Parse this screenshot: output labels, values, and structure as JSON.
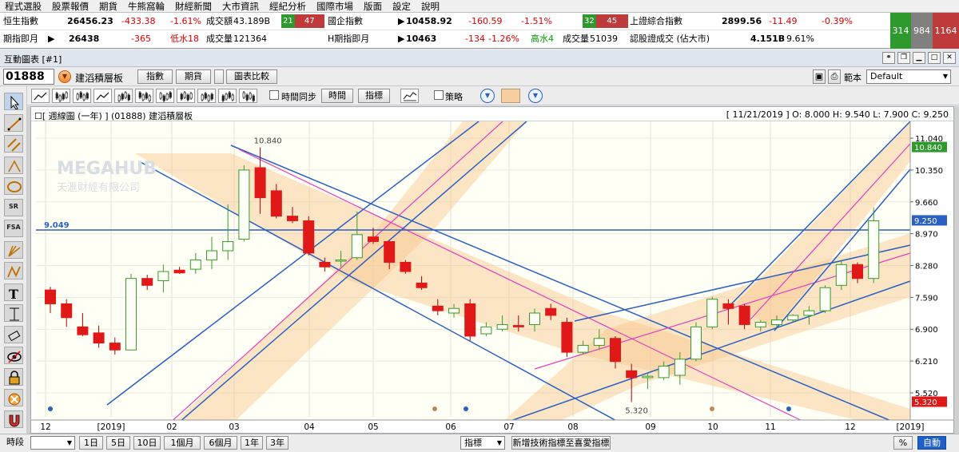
{
  "menu": [
    "程式選股",
    "股票報價",
    "期貨",
    "牛熊窩輪",
    "財經新聞",
    "大市資訊",
    "經紀分析",
    "國際市場",
    "版面",
    "設定",
    "說明"
  ],
  "ticker": {
    "r1": {
      "hsi_label": "恒生指數",
      "hsi_value": "26456.23",
      "hsi_change": "-433.38",
      "hsi_pct": "-1.61%",
      "turnover_label": "成交額",
      "turnover_value": "43.189B",
      "adv_up": "21",
      "adv_down": "47",
      "hsce_label": "國企指數",
      "hsce_value": "10458.92",
      "hsce_change": "-160.59",
      "hsce_pct": "-1.51%",
      "adv2_up": "32",
      "adv2_down": "45",
      "sse_label": "上證綜合指數",
      "sse_value": "2899.56",
      "sse_change": "-11.49",
      "sse_pct": "-0.39%"
    },
    "r2": {
      "fut_label": "期指即月",
      "fut_value": "26438",
      "fut_change": "-365",
      "fut_note": "低水18",
      "vol_label": "成交量",
      "vol_value": "121364",
      "hfut_label": "H期指即月",
      "hfut_value": "10463",
      "hfut_change": "-134",
      "hfut_pct": "-1.26%",
      "hfut_note": "高水4",
      "hvol_label": "成交量",
      "hvol_value": "51039",
      "warrant_label": "認股證成交 (佔大市)",
      "warrant_value": "4.151B",
      "warrant_pct": "9.61%"
    },
    "breadth": {
      "up": "314",
      "flat": "984",
      "down": "1164"
    },
    "colors": {
      "up": "#2e9a2e",
      "flat": "#808080",
      "down": "#bf3a3a"
    }
  },
  "window": {
    "title": "互動圖表 [#1]"
  },
  "control": {
    "code": "01888",
    "name": "建滔積層板",
    "btn_index": "指數",
    "btn_futures": "期貨",
    "btn_compare": "圖表比較",
    "scope_label": "範本",
    "scope_value": "Default"
  },
  "toolbar": {
    "sync_label": "時間同步",
    "time_btn": "時間",
    "indicator_btn": "指標",
    "strategy_label": "策略"
  },
  "left_tools": [
    "pointer-tool",
    "line-tool",
    "parallel-tool",
    "fibo-arc-tool",
    "ellipse-tool",
    "sr-tool",
    "fsa-tool",
    "fan-tool",
    "retrace-tool",
    "text-tool",
    "range-tool",
    "eraser-tool",
    "hide-tool",
    "lock-tool",
    "delete-tool",
    "magnet-tool"
  ],
  "chart": {
    "header_left": "週線圖 (一年) ] (01888) 建滔積層板",
    "header_right": "[ 11/21/2019 ]  O: 8.000  H: 9.540  L: 7.900  C: 9.250",
    "watermark_main": "MEGAHUB",
    "watermark_sub": "天滙財經有限公司"
  },
  "chart_data": {
    "type": "candlestick",
    "interval": "weekly",
    "y_ticks": [
      11.04,
      10.35,
      9.66,
      8.97,
      8.28,
      7.59,
      6.9,
      6.21,
      5.52
    ],
    "ylim": [
      5.0,
      11.3
    ],
    "x_ticks": [
      "12",
      "[2019]",
      "02",
      "03",
      "04",
      "05",
      "06",
      "07",
      "08",
      "09",
      "10",
      "11",
      "12",
      "[2019]"
    ],
    "high_label": "10.840",
    "low_label": "5.320",
    "hline_label": "9.049",
    "hline_value": 9.049,
    "last_value_label": "9.250",
    "max_value_label": "10.840",
    "min_value_label": "5.320",
    "candles": [
      {
        "o": 7.75,
        "h": 7.82,
        "l": 7.25,
        "c": 7.45
      },
      {
        "o": 7.45,
        "h": 7.55,
        "l": 6.95,
        "c": 7.15
      },
      {
        "o": 6.95,
        "h": 7.25,
        "l": 6.75,
        "c": 6.78
      },
      {
        "o": 6.82,
        "h": 6.98,
        "l": 6.5,
        "c": 6.6
      },
      {
        "o": 6.6,
        "h": 6.72,
        "l": 6.35,
        "c": 6.45
      },
      {
        "o": 6.45,
        "h": 8.1,
        "l": 6.45,
        "c": 8.0
      },
      {
        "o": 8.0,
        "h": 8.08,
        "l": 7.75,
        "c": 7.85
      },
      {
        "o": 7.95,
        "h": 8.3,
        "l": 7.7,
        "c": 8.15
      },
      {
        "o": 8.18,
        "h": 8.25,
        "l": 8.1,
        "c": 8.12
      },
      {
        "o": 8.2,
        "h": 8.55,
        "l": 8.1,
        "c": 8.4
      },
      {
        "o": 8.4,
        "h": 8.9,
        "l": 8.2,
        "c": 8.6
      },
      {
        "o": 8.6,
        "h": 9.6,
        "l": 8.4,
        "c": 8.8
      },
      {
        "o": 8.85,
        "h": 10.45,
        "l": 8.8,
        "c": 10.35
      },
      {
        "o": 10.4,
        "h": 10.84,
        "l": 9.4,
        "c": 9.75
      },
      {
        "o": 9.9,
        "h": 10.05,
        "l": 9.3,
        "c": 9.35
      },
      {
        "o": 9.35,
        "h": 9.55,
        "l": 9.2,
        "c": 9.25
      },
      {
        "o": 9.25,
        "h": 9.35,
        "l": 8.5,
        "c": 8.55
      },
      {
        "o": 8.35,
        "h": 8.45,
        "l": 8.15,
        "c": 8.25
      },
      {
        "o": 8.38,
        "h": 8.6,
        "l": 8.25,
        "c": 8.4
      },
      {
        "o": 8.45,
        "h": 9.45,
        "l": 8.4,
        "c": 8.95
      },
      {
        "o": 8.9,
        "h": 9.1,
        "l": 8.75,
        "c": 8.8
      },
      {
        "o": 8.8,
        "h": 8.82,
        "l": 8.2,
        "c": 8.35
      },
      {
        "o": 8.35,
        "h": 8.4,
        "l": 8.1,
        "c": 8.15
      },
      {
        "o": 7.9,
        "h": 8.05,
        "l": 7.75,
        "c": 7.8
      },
      {
        "o": 7.4,
        "h": 7.55,
        "l": 7.2,
        "c": 7.3
      },
      {
        "o": 7.25,
        "h": 7.45,
        "l": 7.15,
        "c": 7.35
      },
      {
        "o": 7.45,
        "h": 7.55,
        "l": 6.65,
        "c": 6.75
      },
      {
        "o": 6.8,
        "h": 7.05,
        "l": 6.75,
        "c": 6.95
      },
      {
        "o": 6.9,
        "h": 7.2,
        "l": 6.85,
        "c": 7.0
      },
      {
        "o": 6.98,
        "h": 7.2,
        "l": 6.85,
        "c": 6.95
      },
      {
        "o": 7.0,
        "h": 7.35,
        "l": 6.85,
        "c": 7.25
      },
      {
        "o": 7.35,
        "h": 7.45,
        "l": 7.1,
        "c": 7.2
      },
      {
        "o": 7.05,
        "h": 7.15,
        "l": 6.3,
        "c": 6.4
      },
      {
        "o": 6.4,
        "h": 6.65,
        "l": 6.35,
        "c": 6.55
      },
      {
        "o": 6.55,
        "h": 6.9,
        "l": 6.45,
        "c": 6.7
      },
      {
        "o": 6.7,
        "h": 6.75,
        "l": 6.05,
        "c": 6.2
      },
      {
        "o": 6.0,
        "h": 6.15,
        "l": 5.32,
        "c": 5.85
      },
      {
        "o": 5.85,
        "h": 5.95,
        "l": 5.6,
        "c": 5.88
      },
      {
        "o": 5.85,
        "h": 6.2,
        "l": 5.8,
        "c": 6.1
      },
      {
        "o": 5.9,
        "h": 6.4,
        "l": 5.7,
        "c": 6.25
      },
      {
        "o": 6.25,
        "h": 7.05,
        "l": 6.2,
        "c": 6.95
      },
      {
        "o": 6.95,
        "h": 7.6,
        "l": 6.9,
        "c": 7.55
      },
      {
        "o": 7.45,
        "h": 7.55,
        "l": 7.0,
        "c": 7.35
      },
      {
        "o": 7.4,
        "h": 7.45,
        "l": 6.9,
        "c": 7.0
      },
      {
        "o": 6.95,
        "h": 7.1,
        "l": 6.85,
        "c": 7.05
      },
      {
        "o": 7.0,
        "h": 7.2,
        "l": 6.95,
        "c": 7.1
      },
      {
        "o": 7.1,
        "h": 7.22,
        "l": 7.05,
        "c": 7.2
      },
      {
        "o": 7.2,
        "h": 7.4,
        "l": 7.0,
        "c": 7.3
      },
      {
        "o": 7.3,
        "h": 7.85,
        "l": 7.25,
        "c": 7.8
      },
      {
        "o": 7.85,
        "h": 8.4,
        "l": 7.75,
        "c": 8.3
      },
      {
        "o": 8.3,
        "h": 8.35,
        "l": 7.9,
        "c": 8.0
      },
      {
        "o": 8.0,
        "h": 9.54,
        "l": 7.9,
        "c": 9.25
      }
    ]
  }
}
